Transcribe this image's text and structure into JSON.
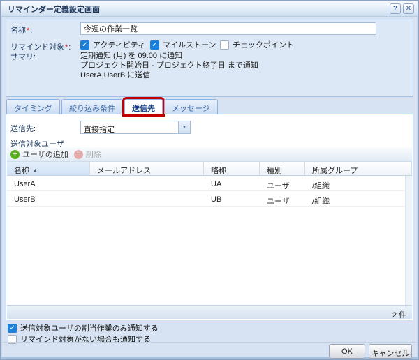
{
  "dialog": {
    "title": "リマインダー定義設定画面",
    "help_glyph": "?",
    "close_glyph": "✕"
  },
  "form": {
    "name_label": "名称",
    "required_mark": "*",
    "colon": ":",
    "name_value": "今週の作業一覧",
    "target_label": "リマインド対象",
    "targets": [
      {
        "label": "アクティビティ",
        "checked": true
      },
      {
        "label": "マイルストーン",
        "checked": true
      },
      {
        "label": "チェックポイント",
        "checked": false
      }
    ],
    "summary_label": "サマリ:",
    "summary_lines": [
      "定期通知 (月) を 09:00 に通知",
      "プロジェクト開始日 - プロジェクト終了日 まで通知",
      "UserA,UserB に送信"
    ]
  },
  "tabs": [
    {
      "label": "タイミング",
      "active": false
    },
    {
      "label": "絞り込み条件",
      "active": false
    },
    {
      "label": "送信先",
      "active": true,
      "annotated": true
    },
    {
      "label": "メッセージ",
      "active": false
    }
  ],
  "destination": {
    "label": "送信先:",
    "selected_value": "直接指定",
    "dropdown_glyph": "▼",
    "section_label": "送信対象ユーザ",
    "toolbar": {
      "add_label": "ユーザの追加",
      "add_glyph": "+",
      "delete_label": "削除",
      "delete_glyph": "−"
    },
    "table": {
      "columns": [
        "名称",
        "メールアドレス",
        "略称",
        "種別",
        "所属グループ"
      ],
      "sort_column": "名称",
      "sort_glyph": "▲",
      "rows": [
        {
          "name": "UserA",
          "email": "",
          "abbr": "UA",
          "type": "ユーザ",
          "group": "/組織"
        },
        {
          "name": "UserB",
          "email": "",
          "abbr": "UB",
          "type": "ユーザ",
          "group": "/組織"
        }
      ],
      "count_text": "2 件"
    }
  },
  "options": [
    {
      "label": "送信対象ユーザの割当作業のみ通知する",
      "checked": true
    },
    {
      "label": "リマインド対象がない場合も通知する",
      "checked": false
    }
  ],
  "footer": {
    "ok_label": "OK",
    "cancel_label": "キャンセル"
  },
  "colors": {
    "annotation_red": "#c40000",
    "checkbox_blue": "#1d80d8",
    "panel_border": "#99bbe8",
    "add_icon_green": "#56b214",
    "delete_icon_red": "#e2574c",
    "title_text": "#223a5e"
  }
}
